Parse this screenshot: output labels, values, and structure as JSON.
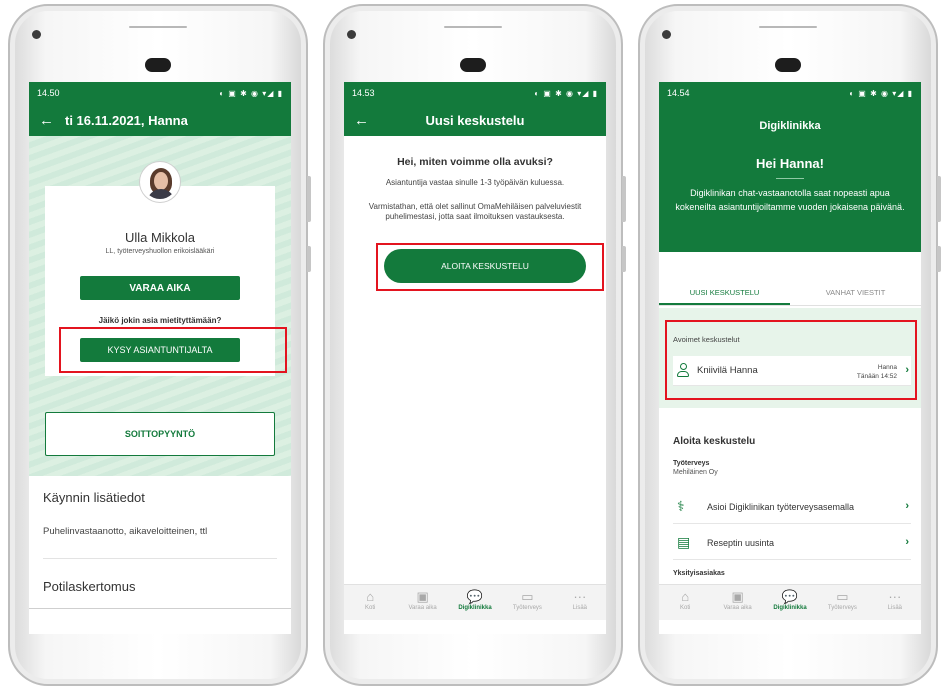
{
  "colors": {
    "brand_green": "#137a3c",
    "highlight_red": "#e3141f",
    "light_green": "#dcf0e2"
  },
  "bottom_nav": {
    "items": [
      {
        "icon": "home-icon",
        "label": "Koti"
      },
      {
        "icon": "calendar-plus-icon",
        "label": "Varaa aika"
      },
      {
        "icon": "chat-icon",
        "label": "Digiklinikka"
      },
      {
        "icon": "briefcase-icon",
        "label": "Työterveys"
      },
      {
        "icon": "more-icon",
        "label": "Lisää"
      }
    ]
  },
  "phone1": {
    "status": {
      "time": "14.50"
    },
    "appbar": {
      "title": "ti 16.11.2021, Hanna"
    },
    "doctor": {
      "name": "Ulla Mikkola",
      "title": "LL, työterveyshuollon erikoislääkäri"
    },
    "book_button": "VARAA AIKA",
    "question": "Jäikö jokin asia mietityttämään?",
    "ask_button": "KYSY ASIANTUNTIJALTA",
    "callback_button": "SOITTOPYYNTÖ",
    "details_heading": "Käynnin lisätiedot",
    "details_text": "Puhelinvastaanotto, aikaveloitteinen, ttl",
    "records_heading": "Potilaskertomus"
  },
  "phone2": {
    "status": {
      "time": "14.53"
    },
    "appbar": {
      "title": "Uusi keskustelu"
    },
    "heading": "Hei, miten voimme olla avuksi?",
    "line1": "Asiantuntija vastaa sinulle 1-3 työpäivän kuluessa.",
    "line2": "Varmistathan, että olet sallinut OmaMehiläisen palveluviestit puhelimestasi, jotta saat ilmoituksen vastauksesta.",
    "start_button": "ALOITA KESKUSTELU"
  },
  "phone3": {
    "status": {
      "time": "14.54"
    },
    "app_title": "Digiklinikka",
    "greeting": "Hei Hanna!",
    "intro": "Digiklinikan chat-vastaanotolla saat nopeasti apua kokeneilta asiantuntijoiltamme vuoden jokaisena päivänä.",
    "tabs": [
      "UUSI KESKUSTELU",
      "VANHAT VIESTIT"
    ],
    "open_label": "Avoimet keskustelut",
    "conversation": {
      "name": "Kniivilä Hanna",
      "sender": "Hanna",
      "time": "Tänään 14:52"
    },
    "start_heading": "Aloita keskustelu",
    "group_title": "Työterveys",
    "group_subtitle": "Mehiläinen Oy",
    "services": [
      {
        "icon": "stethoscope-icon",
        "label": "Asioi Digiklinikan työterveysasemalla"
      },
      {
        "icon": "prescription-icon",
        "label": "Reseptin uusinta"
      }
    ],
    "private_heading": "Yksityisasiakas"
  }
}
